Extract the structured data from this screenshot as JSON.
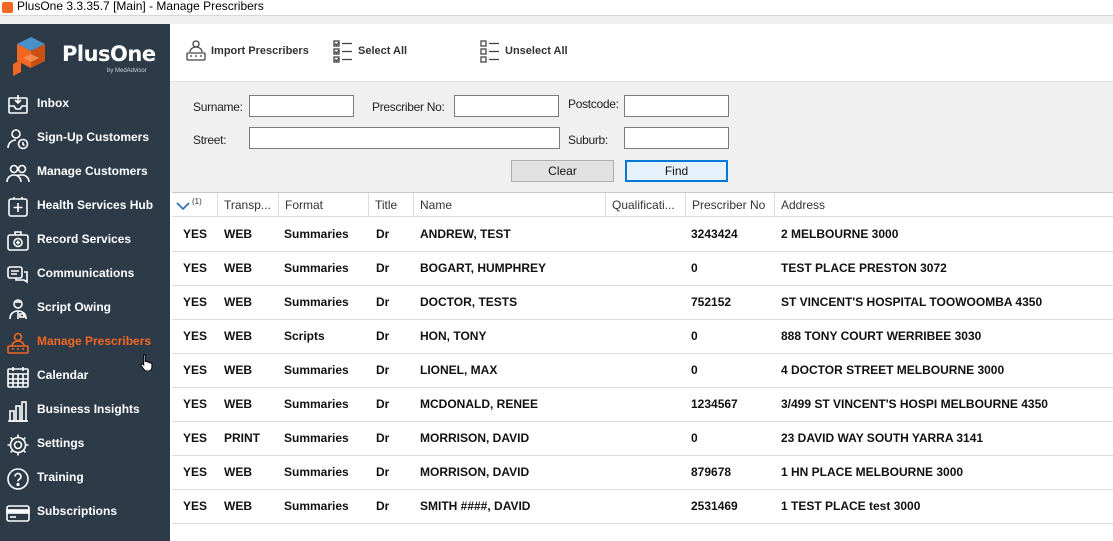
{
  "window": {
    "title": "PlusOne 3.3.35.7 [Main] - Manage Prescribers"
  },
  "brand": {
    "name": "PlusOne",
    "tagline": "by MedAdvisor",
    "accent": "#f26722"
  },
  "sidebar": {
    "items": [
      {
        "label": "Inbox",
        "icon": "inbox-icon"
      },
      {
        "label": "Sign-Up Customers",
        "icon": "user-add-icon"
      },
      {
        "label": "Manage Customers",
        "icon": "users-icon"
      },
      {
        "label": "Health Services Hub",
        "icon": "health-plus-icon"
      },
      {
        "label": "Record Services",
        "icon": "medical-kit-icon"
      },
      {
        "label": "Communications",
        "icon": "chat-icon"
      },
      {
        "label": "Script Owing",
        "icon": "pharmacist-icon"
      },
      {
        "label": "Manage Prescribers",
        "icon": "prescribers-icon",
        "active": true
      },
      {
        "label": "Calendar",
        "icon": "calendar-icon"
      },
      {
        "label": "Business Insights",
        "icon": "bar-chart-icon"
      },
      {
        "label": "Settings",
        "icon": "gear-icon"
      },
      {
        "label": "Training",
        "icon": "question-icon"
      },
      {
        "label": "Subscriptions",
        "icon": "credit-card-icon"
      }
    ]
  },
  "toolbar": {
    "import_label": "Import Prescribers",
    "select_all_label": "Select All",
    "unselect_all_label": "Unselect All"
  },
  "filters": {
    "surname_label": "Surname:",
    "prescriber_no_label": "Prescriber No:",
    "postcode_label": "Postcode:",
    "street_label": "Street:",
    "suburb_label": "Suburb:",
    "surname_value": "",
    "prescriber_no_value": "",
    "postcode_value": "",
    "street_value": "",
    "suburb_value": "",
    "clear_label": "Clear",
    "find_label": "Find"
  },
  "grid": {
    "sort_count": "(1)",
    "columns": [
      "",
      "Transp...",
      "Format",
      "Title",
      "Name",
      "Qualificati...",
      "Prescriber No",
      "Address"
    ],
    "rows": [
      [
        "YES",
        "WEB",
        "Summaries",
        "Dr",
        "ANDREW, TEST",
        "",
        "3243424",
        "2 MELBOURNE 3000"
      ],
      [
        "YES",
        "WEB",
        "Summaries",
        "Dr",
        "BOGART, HUMPHREY",
        "",
        "0",
        "TEST PLACE PRESTON 3072"
      ],
      [
        "YES",
        "WEB",
        "Summaries",
        "Dr",
        "DOCTOR, TESTS",
        "",
        "752152",
        "ST VINCENT'S HOSPITAL TOOWOOMBA 4350"
      ],
      [
        "YES",
        "WEB",
        "Scripts",
        "Dr",
        "HON, TONY",
        "",
        "0",
        "888 TONY COURT WERRIBEE 3030"
      ],
      [
        "YES",
        "WEB",
        "Summaries",
        "Dr",
        "LIONEL, MAX",
        "",
        "0",
        "4 DOCTOR STREET MELBOURNE 3000"
      ],
      [
        "YES",
        "WEB",
        "Summaries",
        "Dr",
        "MCDONALD, RENEE",
        "",
        "1234567",
        "3/499 ST VINCENT'S HOSPI MELBOURNE 4350"
      ],
      [
        "YES",
        "PRINT",
        "Summaries",
        "Dr",
        "MORRISON, DAVID",
        "",
        "0",
        "23 DAVID WAY SOUTH YARRA 3141"
      ],
      [
        "YES",
        "WEB",
        "Summaries",
        "Dr",
        "MORRISON, DAVID",
        "",
        "879678",
        "1 HN PLACE MELBOURNE 3000"
      ],
      [
        "YES",
        "WEB",
        "Summaries",
        "Dr",
        "SMITH ####, DAVID",
        "",
        "2531469",
        "1 TEST PLACE test 3000"
      ]
    ]
  }
}
